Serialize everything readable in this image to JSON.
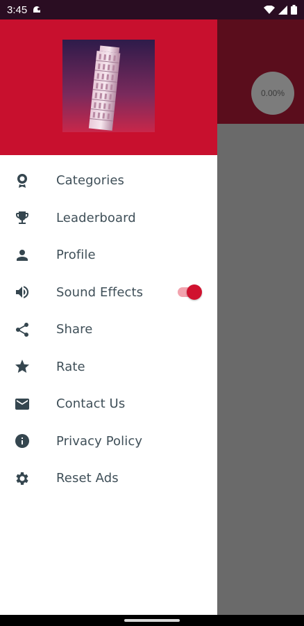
{
  "status_bar": {
    "time": "3:45",
    "icons": [
      "notification-icon",
      "wifi-icon",
      "signal-icon",
      "battery-icon"
    ]
  },
  "background": {
    "progress_text": "0.00%",
    "header_color": "#5a0d1c"
  },
  "drawer": {
    "header_color": "#c8102e",
    "header_image": "leaning-tower-of-pisa",
    "items": [
      {
        "label": "Categories",
        "icon": "award-icon"
      },
      {
        "label": "Leaderboard",
        "icon": "trophy-icon"
      },
      {
        "label": "Profile",
        "icon": "person-icon"
      },
      {
        "label": "Sound Effects",
        "icon": "volume-icon",
        "toggle": true,
        "toggle_on": true
      },
      {
        "label": "Share",
        "icon": "share-icon"
      },
      {
        "label": "Rate",
        "icon": "star-icon"
      },
      {
        "label": "Contact Us",
        "icon": "mail-icon"
      },
      {
        "label": "Privacy Policy",
        "icon": "info-icon"
      },
      {
        "label": "Reset Ads",
        "icon": "gear-icon"
      }
    ]
  },
  "colors": {
    "accent": "#c8102e",
    "icon": "#35464f",
    "text": "#3f4f58"
  }
}
